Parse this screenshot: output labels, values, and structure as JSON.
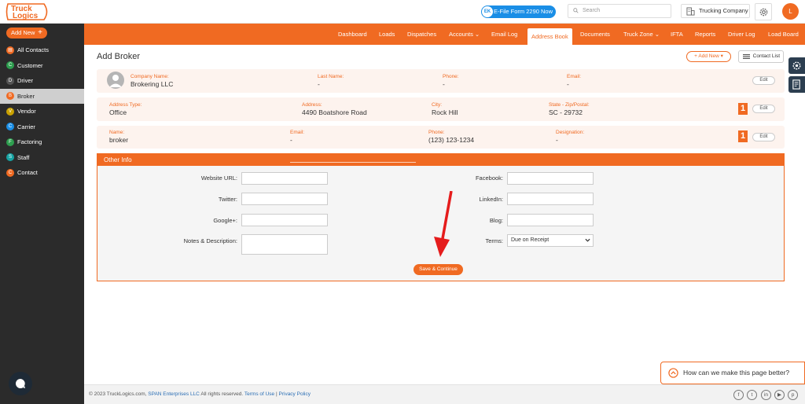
{
  "header": {
    "efile_badge": "EK",
    "efile_label": "E-File Form 2290 Now",
    "search_placeholder": "Search",
    "company_name": "Trucking Company",
    "avatar_letter": "L",
    "logo_text": "TruckLogics"
  },
  "sidebar": {
    "add_new": "Add New",
    "items": [
      {
        "label": "All Contacts",
        "letter": "▤",
        "color": "#f06a22"
      },
      {
        "label": "Customer",
        "letter": "C",
        "color": "#2e9e4f"
      },
      {
        "label": "Driver",
        "letter": "D",
        "color": "#555555"
      },
      {
        "label": "Broker",
        "letter": "B",
        "color": "#f06a22"
      },
      {
        "label": "Vendor",
        "letter": "V",
        "color": "#c9a100"
      },
      {
        "label": "Carrier",
        "letter": "C",
        "color": "#1a8ee6"
      },
      {
        "label": "Factoring",
        "letter": "F",
        "color": "#2e9e4f"
      },
      {
        "label": "Staff",
        "letter": "S",
        "color": "#16a3a3"
      },
      {
        "label": "Contact",
        "letter": "C",
        "color": "#f06a22"
      }
    ]
  },
  "nav": {
    "items": [
      "Dashboard",
      "Loads",
      "Dispatches",
      "Accounts ⌄",
      "Email Log",
      "Address Book",
      "Documents",
      "Truck Zone ⌄",
      "IFTA",
      "Reports",
      "Driver Log",
      "Load Board"
    ],
    "active": "Address Book"
  },
  "page": {
    "title": "Add Broker",
    "add_new": "+ Add New ▾",
    "contact_list": "Contact List",
    "edit": "Edit",
    "badge": "1"
  },
  "company_card": {
    "company_name_label": "Company Name:",
    "company_name": "Brokering LLC",
    "last_name_label": "Last Name:",
    "last_name": "-",
    "phone_label": "Phone:",
    "phone": "-",
    "email_label": "Email:",
    "email": "-"
  },
  "address_card": {
    "type_label": "Address Type:",
    "type": "Office",
    "address_label": "Address:",
    "address": "4490 Boatshore Road",
    "city_label": "City:",
    "city": "Rock Hill",
    "state_label": "State - Zip/Postal:",
    "state": "SC - 29732"
  },
  "contact_card": {
    "name_label": "Name:",
    "name": "broker",
    "email_label": "Email:",
    "email": "-",
    "phone_label": "Phone:",
    "phone": "(123) 123-1234",
    "designation_label": "Designation:",
    "designation": "-"
  },
  "other_info": {
    "title": "Other Info",
    "website_label": "Website URL:",
    "twitter_label": "Twitter:",
    "google_label": "Google+:",
    "notes_label": "Notes & Description:",
    "facebook_label": "Facebook:",
    "linkedin_label": "LinkedIn:",
    "blog_label": "Blog:",
    "terms_label": "Terms:",
    "terms_value": "Due on Receipt",
    "save": "Save & Continue"
  },
  "feedback": "How can we make this page better?",
  "footer": {
    "copyright": "© 2023 TruckLogics.com,",
    "span": "SPAN Enterprises LLC",
    "rights": "All rights reserved.",
    "terms": "Terms of Use",
    "sep": "|",
    "privacy": "Privacy Policy",
    "social": [
      "f",
      "t",
      "in",
      "▶",
      "p"
    ]
  },
  "colors": {
    "accent": "#f06a22",
    "sidebar": "#2b2b2b",
    "blue": "#1a8ee6"
  }
}
